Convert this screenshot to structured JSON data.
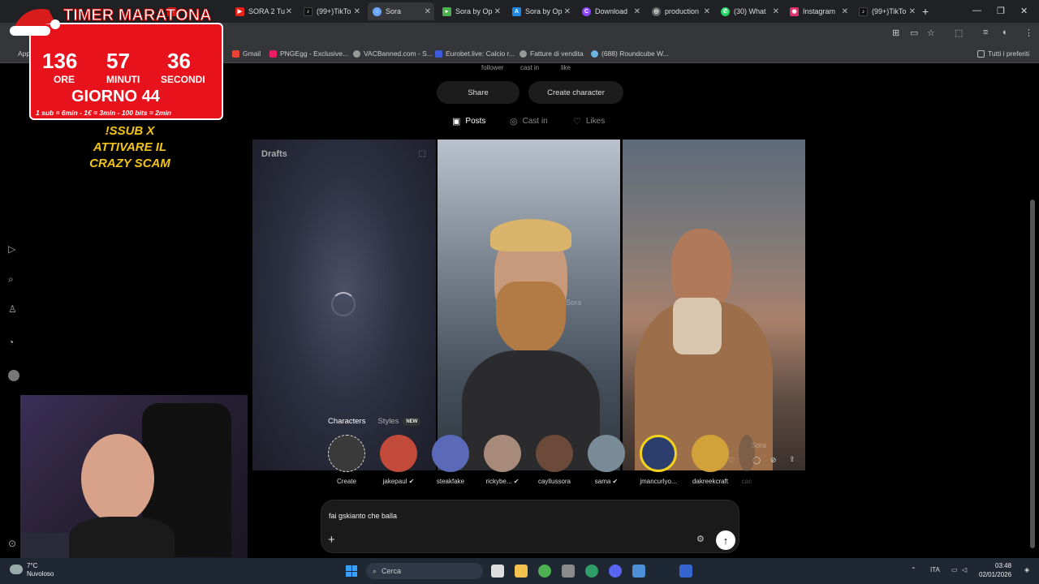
{
  "browser": {
    "tabs": [
      {
        "label": "",
        "favicon": "youtube-icon",
        "color": "#e62117"
      },
      {
        "label": "SORA 2 Tu",
        "favicon": "youtube-icon",
        "color": "#e62117"
      },
      {
        "label": "(99+)TikTo",
        "favicon": "tiktok-icon",
        "color": "#111111"
      },
      {
        "label": "Sora",
        "favicon": "sora-icon",
        "color": "#6aa5ff"
      },
      {
        "label": "Sora by Op",
        "favicon": "bookmark-icon",
        "color": "#4caf50"
      },
      {
        "label": "Sora by Op",
        "favicon": "translate-icon",
        "color": "#1e88e5"
      },
      {
        "label": "Download",
        "favicon": "canva-icon",
        "color": "#8e44ff"
      },
      {
        "label": "production",
        "favicon": "globe-icon",
        "color": "#888888"
      },
      {
        "label": "(30) What",
        "favicon": "whatsapp-icon",
        "color": "#25d366"
      },
      {
        "label": "Instagram",
        "favicon": "instagram-icon",
        "color": "#e1306c"
      },
      {
        "label": "(99+)TikTo",
        "favicon": "tiktok-icon",
        "color": "#111111"
      }
    ],
    "new_tab": "+",
    "bookmarks": [
      {
        "label": "Gmail",
        "color": "#ea4335"
      },
      {
        "label": "PNGEgg - Exclusive...",
        "color": "#e91e63"
      },
      {
        "label": "VACBanned.com - S...",
        "color": "#999999"
      },
      {
        "label": "Eurobet.live: Calcio r...",
        "color": "#3b5bdb"
      },
      {
        "label": "Fatture di vendita",
        "color": "#999999"
      },
      {
        "label": "(688) Roundcube W...",
        "color": "#6cb4e4"
      }
    ],
    "bookmarks_right": "Tutti i preferiti",
    "bookmarks_left": "App"
  },
  "profile": {
    "stats": [
      "follower",
      "cast in",
      "like"
    ],
    "share_button": "Share",
    "create_character_button": "Create character",
    "tabs": [
      {
        "label": "Posts",
        "icon": "posts-icon",
        "active": true
      },
      {
        "label": "Cast in",
        "icon": "cast-in-icon",
        "active": false
      },
      {
        "label": "Likes",
        "icon": "heart-icon",
        "active": false
      }
    ],
    "drafts_label": "Drafts",
    "watermark": "Sora"
  },
  "characters": {
    "tab_characters": "Characters",
    "tab_styles": "Styles",
    "new_badge": "NEW",
    "items": [
      {
        "name": "Create",
        "verified": false,
        "color": "#3a3a3a"
      },
      {
        "name": "jakepaul",
        "verified": true,
        "color": "#c24a3a"
      },
      {
        "name": "steakfake",
        "verified": false,
        "color": "#5a6ab8"
      },
      {
        "name": "rickybe...",
        "verified": true,
        "color": "#a88a7a"
      },
      {
        "name": "cayllussora",
        "verified": false,
        "color": "#6b4a3a"
      },
      {
        "name": "sama",
        "verified": true,
        "color": "#7a8b98"
      },
      {
        "name": "jmancurlyo...",
        "verified": false,
        "color": "#2c3e6e"
      },
      {
        "name": "dakreekcraft",
        "verified": false,
        "color": "#d1a23a"
      },
      {
        "name": "cac",
        "verified": false,
        "color": "#444444"
      }
    ]
  },
  "prompt": {
    "value": "fai gskianto che balla",
    "plus": "+",
    "send": "↑"
  },
  "overlay": {
    "timer_title": "TIMER MARATONA",
    "hours": "136",
    "minutes": "57",
    "seconds": "36",
    "hours_label": "ORE",
    "minutes_label": "MINUTI",
    "seconds_label": "SECONDI",
    "day": "GIORNO 44",
    "rate": "1 sub = 6min - 1€ = 3min - 100 bits = 2min",
    "sub_text_1": "!SSUB X",
    "sub_text_2": "ATTIVARE IL",
    "sub_text_3": "CRAZY SCAM"
  },
  "taskbar": {
    "temperature": "7°C",
    "weather": "Nuvoloso",
    "search_placeholder": "Cerca",
    "language": "ITA",
    "time": "03:48",
    "date": "02/01/2026"
  }
}
